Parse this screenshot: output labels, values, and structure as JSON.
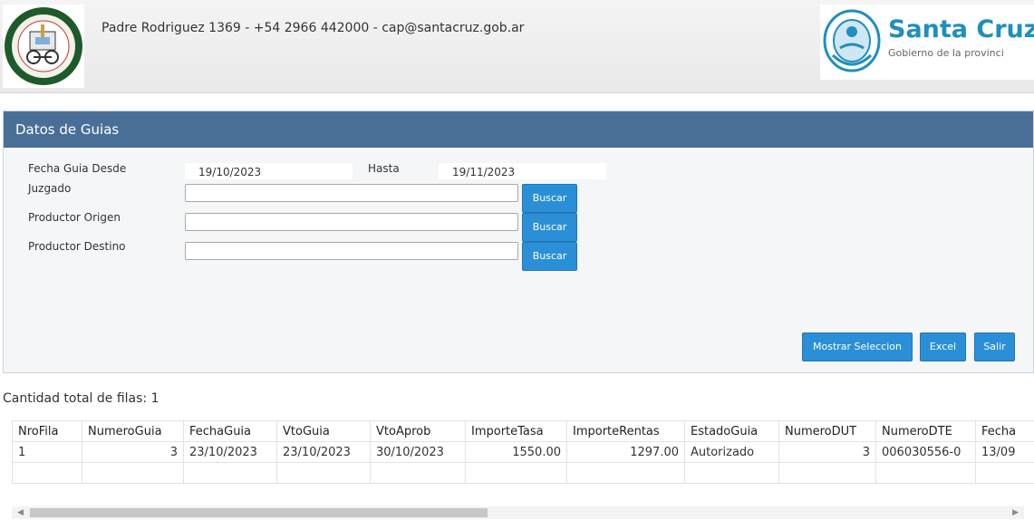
{
  "header": {
    "contact": "Padre Rodriguez 1369 - +54 2966 442000 - cap@santacruz.gob.ar",
    "brand_title": "Santa Cruz",
    "brand_subtitle": "Gobierno de la provinci"
  },
  "panel": {
    "title": "Datos de Guias",
    "fecha_desde_label": "Fecha Guia Desde",
    "fecha_desde_value": "19/10/2023",
    "hasta_label": "Hasta",
    "hasta_value": "19/11/2023",
    "juzgado_label": "Juzgado",
    "productor_origen_label": "Productor Origen",
    "productor_destino_label": "Productor Destino",
    "buscar_label": "Buscar",
    "mostrar_label": "Mostrar Seleccion",
    "excel_label": "Excel",
    "salir_label": "Salir"
  },
  "results": {
    "count_text": "Cantidad total de filas: 1",
    "columns": [
      "NroFila",
      "NumeroGuia",
      "FechaGuia",
      "VtoGuia",
      "VtoAprob",
      "ImporteTasa",
      "ImporteRentas",
      "EstadoGuia",
      "NumeroDUT",
      "NumeroDTE",
      "Fecha"
    ],
    "rows": [
      [
        "1",
        "3",
        "23/10/2023",
        "23/10/2023",
        "30/10/2023",
        "1550.00",
        "1297.00",
        "Autorizado",
        "3",
        "006030556-0",
        "13/09"
      ]
    ]
  },
  "colors": {
    "panel_header": "#4a6f97",
    "button": "#2b8fd8",
    "brand": "#1e8fbf"
  }
}
